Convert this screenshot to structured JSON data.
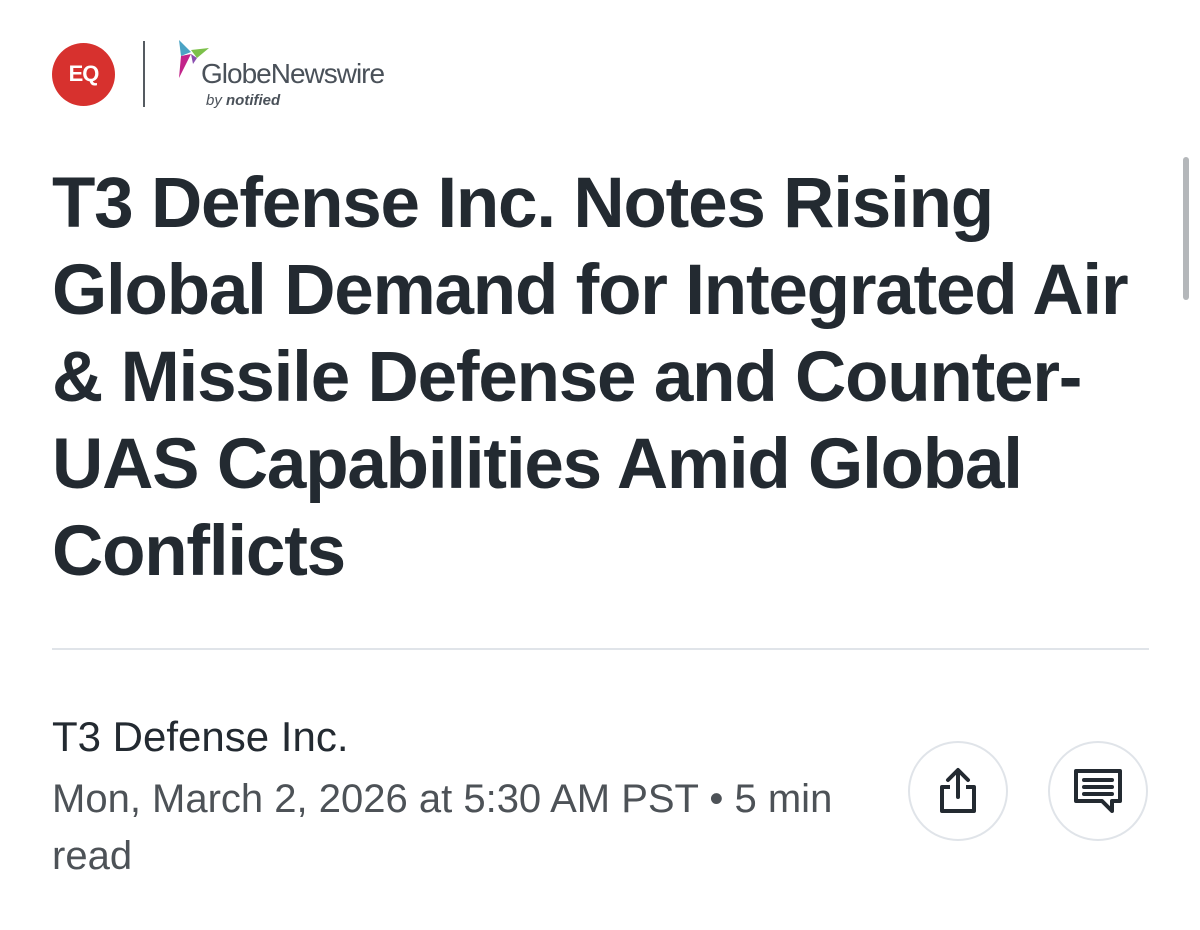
{
  "header": {
    "eq_label": "EQ",
    "provider_name": "GlobeNewswire",
    "provider_sub_prefix": "by",
    "provider_sub_brand": "notified"
  },
  "article": {
    "title": "T3 Defense Inc. Notes Rising Global Demand for Integrated Air & Missile Defense and Counter-UAS Capabilities Amid Global Conflicts",
    "byline": "T3 Defense Inc.",
    "meta": "Mon, March 2, 2026 at 5:30 AM PST • 5 min read"
  },
  "actions": {
    "share_icon": "share-icon",
    "comment_icon": "comment-icon"
  },
  "colors": {
    "eq_red": "#d7312e",
    "headline": "#232a31",
    "meta_text": "#4d5257",
    "divider": "#e0e4e9"
  }
}
